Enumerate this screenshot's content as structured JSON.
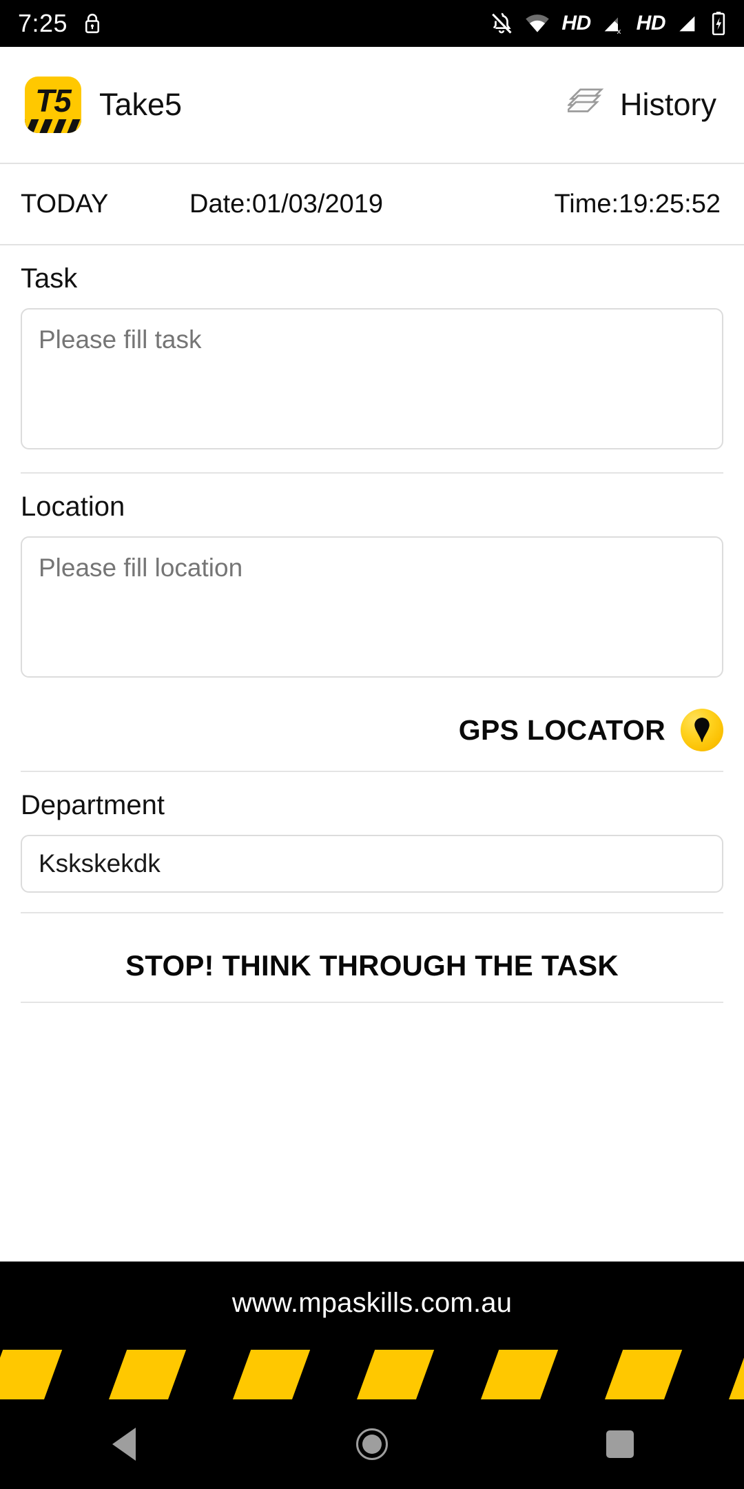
{
  "status_bar": {
    "time": "7:25",
    "icons": [
      {
        "name": "lock-icon"
      },
      {
        "name": "notifications-off-icon"
      },
      {
        "name": "wifi-icon"
      },
      {
        "name": "hd-label-1",
        "text": "HD"
      },
      {
        "name": "cellular-signal-off-icon"
      },
      {
        "name": "hd-label-2",
        "text": "HD"
      },
      {
        "name": "cellular-signal-icon"
      },
      {
        "name": "battery-charging-icon"
      }
    ],
    "hd_label": "HD"
  },
  "header": {
    "logo_text": "T5",
    "app_name": "Take5",
    "history_label": "History",
    "history_icon": "layers-stack-icon",
    "brand_yellow": "#FFC800"
  },
  "date_row": {
    "today_label": "TODAY",
    "date_label": "Date:01/03/2019",
    "time_label": "Time:19:25:52"
  },
  "form": {
    "task": {
      "label": "Task",
      "placeholder": "Please fill task",
      "value": ""
    },
    "location": {
      "label": "Location",
      "placeholder": "Please fill location",
      "value": ""
    },
    "gps": {
      "label": "GPS LOCATOR",
      "icon": "map-pin-icon",
      "button_color": "#FFD21F"
    },
    "department": {
      "label": "Department",
      "placeholder": "",
      "value": "Kskskekdk"
    }
  },
  "banner": {
    "stop_text": "STOP! THINK THROUGH THE TASK"
  },
  "footer": {
    "url": "www.mpaskills.com.au",
    "stripe_color": "#FFC800",
    "background": "#000000"
  },
  "nav_bar": {
    "back": "back-button",
    "home": "home-button",
    "recents": "recents-button"
  }
}
